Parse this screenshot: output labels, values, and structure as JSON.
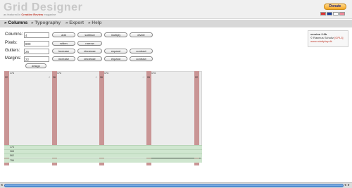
{
  "header": {
    "title": "Grid Designer",
    "subtitle_prefix": "as featured in",
    "subtitle_brand": "Creative Review",
    "subtitle_suffix": "magazine",
    "donate_label": "Donate"
  },
  "tabs": [
    {
      "label": "» Columns"
    },
    {
      "label": "» Typography"
    },
    {
      "label": "» Export"
    },
    {
      "label": "» Help"
    }
  ],
  "form": {
    "columns": {
      "label": "Columns:",
      "value": "4"
    },
    "pixels": {
      "label": "Pixels:",
      "value": "800"
    },
    "gutters": {
      "label": "Gutters:",
      "value": "26"
    },
    "margins": {
      "label": "Margins:",
      "value": "22"
    }
  },
  "buttons": {
    "add": "add",
    "subtract": "subtract",
    "multiply": "multiply",
    "divide": "divide",
    "widen": "widen",
    "narrow": "narrow",
    "g_increase": "increase",
    "g_decrease": "decrease",
    "g_expand": "expand",
    "g_contract": "contract",
    "m_increase": "increase",
    "m_decrease": "decrease",
    "m_expand": "expand",
    "m_contract": "contract",
    "design": "design"
  },
  "version_box": {
    "version": "version 2.6b",
    "author": "© Rasmus Schultz",
    "license": "[GPL3]",
    "url": "www.mindplay.dk"
  },
  "grid": {
    "column_width": "174",
    "margin": "22",
    "gutter": "26",
    "widths": [
      "174",
      "368",
      "562",
      "756"
    ]
  },
  "icons": {
    "arrow": "right-arrow-icon",
    "scroll_left": "scroll-left-icon",
    "scroll_right": "scroll-right-icon"
  },
  "colors": {
    "gutter": "#c99595",
    "canvas": "#ececec",
    "span_bar": "#606060",
    "width_row": "#cfe6cf",
    "scroll_thumb": "#4f8fd8"
  }
}
